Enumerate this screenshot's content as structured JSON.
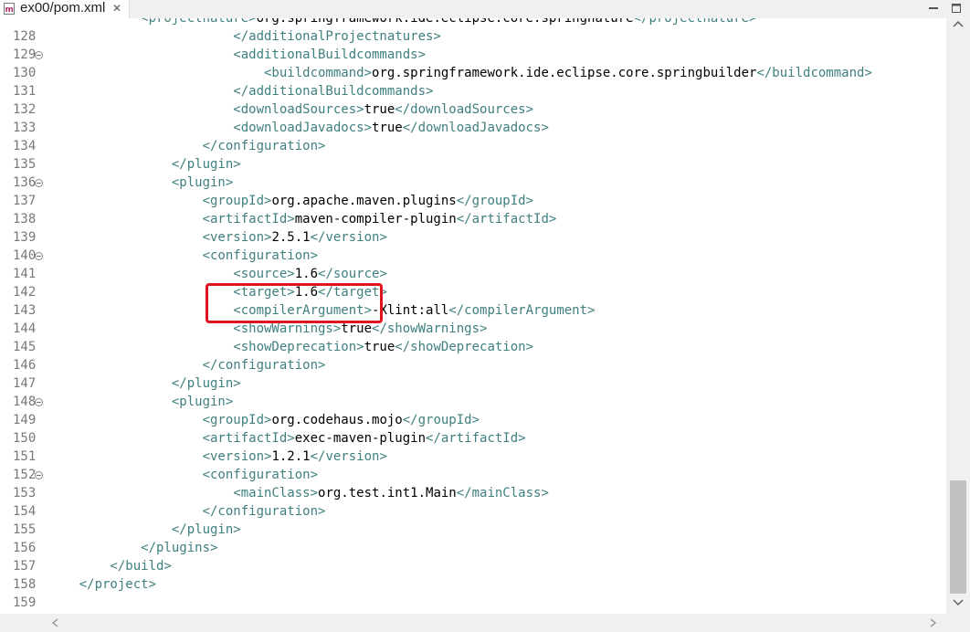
{
  "tab": {
    "title": "ex00/pom.xml",
    "close_icon": "✕",
    "icon": "maven-xml-file-icon"
  },
  "window": {
    "minimize_icon": "minimize-icon",
    "maximize_icon": "maximize-icon"
  },
  "editor": {
    "first_line_partial": [
      {
        "c": "t",
        "s": "            <projectnature>"
      },
      {
        "c": "x",
        "s": "org.springframework.ide.eclipse.core.springnature"
      },
      {
        "c": "t",
        "s": "</projectnature>"
      }
    ],
    "lines": [
      {
        "n": "128",
        "f": false,
        "p": [
          {
            "c": "t",
            "s": "                        </additionalProjectnatures>"
          }
        ]
      },
      {
        "n": "129",
        "f": true,
        "p": [
          {
            "c": "t",
            "s": "                        <additionalBuildcommands>"
          }
        ]
      },
      {
        "n": "130",
        "f": false,
        "p": [
          {
            "c": "t",
            "s": "                            <buildcommand>"
          },
          {
            "c": "x",
            "s": "org.springframework.ide.eclipse.core.springbuilder"
          },
          {
            "c": "t",
            "s": "</buildcommand>"
          }
        ]
      },
      {
        "n": "131",
        "f": false,
        "p": [
          {
            "c": "t",
            "s": "                        </additionalBuildcommands>"
          }
        ]
      },
      {
        "n": "132",
        "f": false,
        "p": [
          {
            "c": "t",
            "s": "                        <downloadSources>"
          },
          {
            "c": "x",
            "s": "true"
          },
          {
            "c": "t",
            "s": "</downloadSources>"
          }
        ]
      },
      {
        "n": "133",
        "f": false,
        "p": [
          {
            "c": "t",
            "s": "                        <downloadJavadocs>"
          },
          {
            "c": "x",
            "s": "true"
          },
          {
            "c": "t",
            "s": "</downloadJavadocs>"
          }
        ]
      },
      {
        "n": "134",
        "f": false,
        "p": [
          {
            "c": "t",
            "s": "                    </configuration>"
          }
        ]
      },
      {
        "n": "135",
        "f": false,
        "p": [
          {
            "c": "t",
            "s": "                </plugin>"
          }
        ]
      },
      {
        "n": "136",
        "f": true,
        "p": [
          {
            "c": "t",
            "s": "                <plugin>"
          }
        ]
      },
      {
        "n": "137",
        "f": false,
        "p": [
          {
            "c": "t",
            "s": "                    <groupId>"
          },
          {
            "c": "x",
            "s": "org.apache.maven.plugins"
          },
          {
            "c": "t",
            "s": "</groupId>"
          }
        ]
      },
      {
        "n": "138",
        "f": false,
        "p": [
          {
            "c": "t",
            "s": "                    <artifactId>"
          },
          {
            "c": "x",
            "s": "maven-compiler-plugin"
          },
          {
            "c": "t",
            "s": "</artifactId>"
          }
        ]
      },
      {
        "n": "139",
        "f": false,
        "p": [
          {
            "c": "t",
            "s": "                    <version>"
          },
          {
            "c": "x",
            "s": "2.5.1"
          },
          {
            "c": "t",
            "s": "</version>"
          }
        ]
      },
      {
        "n": "140",
        "f": true,
        "p": [
          {
            "c": "t",
            "s": "                    <configuration>"
          }
        ]
      },
      {
        "n": "141",
        "f": false,
        "p": [
          {
            "c": "t",
            "s": "                        <source>"
          },
          {
            "c": "x",
            "s": "1.6"
          },
          {
            "c": "t",
            "s": "</source>"
          }
        ]
      },
      {
        "n": "142",
        "f": false,
        "p": [
          {
            "c": "t",
            "s": "                        <target>"
          },
          {
            "c": "x",
            "s": "1.6"
          },
          {
            "c": "t",
            "s": "</target>"
          }
        ]
      },
      {
        "n": "143",
        "f": false,
        "p": [
          {
            "c": "t",
            "s": "                        <compilerArgument>"
          },
          {
            "c": "x",
            "s": "-Xlint:all"
          },
          {
            "c": "t",
            "s": "</compilerArgument>"
          }
        ]
      },
      {
        "n": "144",
        "f": false,
        "p": [
          {
            "c": "t",
            "s": "                        <showWarnings>"
          },
          {
            "c": "x",
            "s": "true"
          },
          {
            "c": "t",
            "s": "</showWarnings>"
          }
        ]
      },
      {
        "n": "145",
        "f": false,
        "p": [
          {
            "c": "t",
            "s": "                        <showDeprecation>"
          },
          {
            "c": "x",
            "s": "true"
          },
          {
            "c": "t",
            "s": "</showDeprecation>"
          }
        ]
      },
      {
        "n": "146",
        "f": false,
        "p": [
          {
            "c": "t",
            "s": "                    </configuration>"
          }
        ]
      },
      {
        "n": "147",
        "f": false,
        "p": [
          {
            "c": "t",
            "s": "                </plugin>"
          }
        ]
      },
      {
        "n": "148",
        "f": true,
        "p": [
          {
            "c": "t",
            "s": "                <plugin>"
          }
        ]
      },
      {
        "n": "149",
        "f": false,
        "p": [
          {
            "c": "t",
            "s": "                    <groupId>"
          },
          {
            "c": "x",
            "s": "org.codehaus.mojo"
          },
          {
            "c": "t",
            "s": "</groupId>"
          }
        ]
      },
      {
        "n": "150",
        "f": false,
        "p": [
          {
            "c": "t",
            "s": "                    <artifactId>"
          },
          {
            "c": "x",
            "s": "exec-maven-plugin"
          },
          {
            "c": "t",
            "s": "</artifactId>"
          }
        ]
      },
      {
        "n": "151",
        "f": false,
        "p": [
          {
            "c": "t",
            "s": "                    <version>"
          },
          {
            "c": "x",
            "s": "1.2.1"
          },
          {
            "c": "t",
            "s": "</version>"
          }
        ]
      },
      {
        "n": "152",
        "f": true,
        "p": [
          {
            "c": "t",
            "s": "                    <configuration>"
          }
        ]
      },
      {
        "n": "153",
        "f": false,
        "p": [
          {
            "c": "t",
            "s": "                        <mainClass>"
          },
          {
            "c": "x",
            "s": "org.test.int1.Main"
          },
          {
            "c": "t",
            "s": "</mainClass>"
          }
        ]
      },
      {
        "n": "154",
        "f": false,
        "p": [
          {
            "c": "t",
            "s": "                    </configuration>"
          }
        ]
      },
      {
        "n": "155",
        "f": false,
        "p": [
          {
            "c": "t",
            "s": "                </plugin>"
          }
        ]
      },
      {
        "n": "156",
        "f": false,
        "p": [
          {
            "c": "t",
            "s": "            </plugins>"
          }
        ]
      },
      {
        "n": "157",
        "f": false,
        "p": [
          {
            "c": "t",
            "s": "        </build>"
          }
        ]
      },
      {
        "n": "158",
        "f": false,
        "p": [
          {
            "c": "t",
            "s": "    </project>"
          }
        ]
      },
      {
        "n": "159",
        "f": false,
        "p": []
      }
    ]
  },
  "colors": {
    "tag": "#3f7f7f",
    "text": "#000000",
    "line_number": "#787878",
    "highlight": "#e0141e"
  }
}
